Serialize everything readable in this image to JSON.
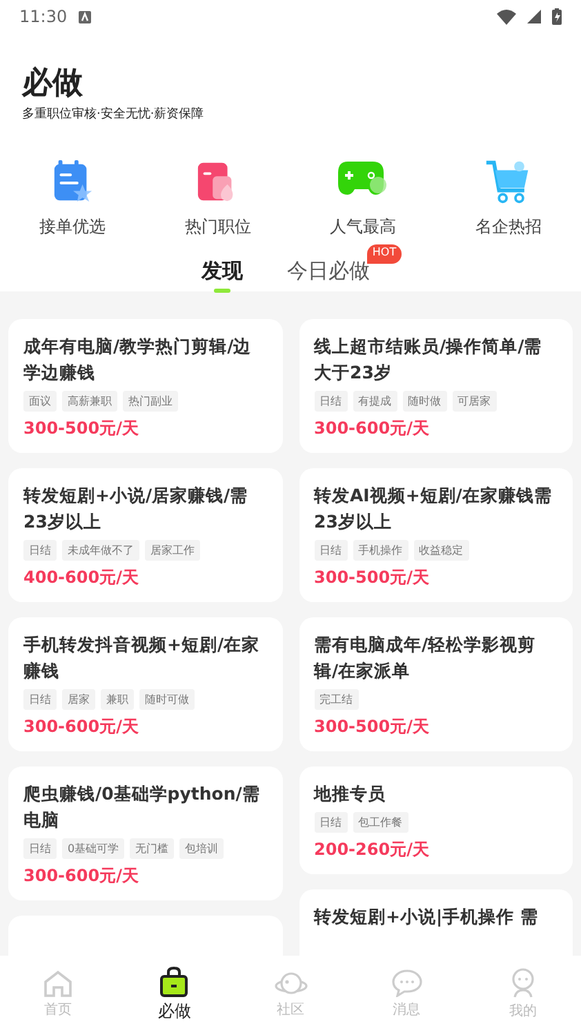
{
  "status_bar": {
    "time": "11:30"
  },
  "header": {
    "title": "必做",
    "subtitle": "多重职位审核·安全无忧·薪资保障"
  },
  "categories": [
    {
      "kind": "notes",
      "label": "接单优选"
    },
    {
      "kind": "card",
      "label": "热门职位"
    },
    {
      "kind": "gamepad",
      "label": "人气最高"
    },
    {
      "kind": "cart",
      "label": "名企热招"
    }
  ],
  "tabs": [
    {
      "label": "发现",
      "selected": true
    },
    {
      "label": "今日必做",
      "selected": false,
      "badge": "HOT"
    }
  ],
  "columns": [
    [
      {
        "title": "成年有电脑/教学热门剪辑/边学边赚钱",
        "tags": [
          "面议",
          "高薪兼职",
          "热门副业"
        ],
        "pay": "300-500元/天"
      },
      {
        "title": "转发短剧+小说/居家赚钱/需23岁以上",
        "tags": [
          "日结",
          "未成年做不了",
          "居家工作"
        ],
        "pay": "400-600元/天"
      },
      {
        "title": "手机转发抖音视频+短剧/在家赚钱",
        "tags": [
          "日结",
          "居家",
          "兼职",
          "随时可做"
        ],
        "pay": "300-600元/天"
      },
      {
        "title": "爬虫赚钱/0基础学python/需电脑",
        "tags": [
          "日结",
          "0基础可学",
          "无门槛",
          "包培训"
        ],
        "pay": "300-600元/天"
      },
      {
        "kind": "cut"
      }
    ],
    [
      {
        "title": "线上超市结账员/操作简单/需大于23岁",
        "tags": [
          "日结",
          "有提成",
          "随时做",
          "可居家"
        ],
        "pay": "300-600元/天"
      },
      {
        "title": "转发AI视频+短剧/在家赚钱需23岁以上",
        "tags": [
          "日结",
          "手机操作",
          "收益稳定"
        ],
        "pay": "300-500元/天"
      },
      {
        "title": "需有电脑成年/轻松学影视剪辑/在家派单",
        "tags": [
          "完工结"
        ],
        "pay": "300-500元/天"
      },
      {
        "title": "地推专员",
        "tags": [
          "日结",
          "包工作餐"
        ],
        "pay": "200-260元/天"
      },
      {
        "kind": "cut",
        "title": "转发短剧+小说|手机操作 需"
      }
    ]
  ],
  "bottom_nav": [
    {
      "kind": "home",
      "label": "首页",
      "selected": false
    },
    {
      "kind": "bag",
      "label": "必做",
      "selected": true
    },
    {
      "kind": "planet",
      "label": "社区",
      "selected": false
    },
    {
      "kind": "chat",
      "label": "消息",
      "selected": false
    },
    {
      "kind": "person",
      "label": "我的",
      "selected": false
    }
  ]
}
